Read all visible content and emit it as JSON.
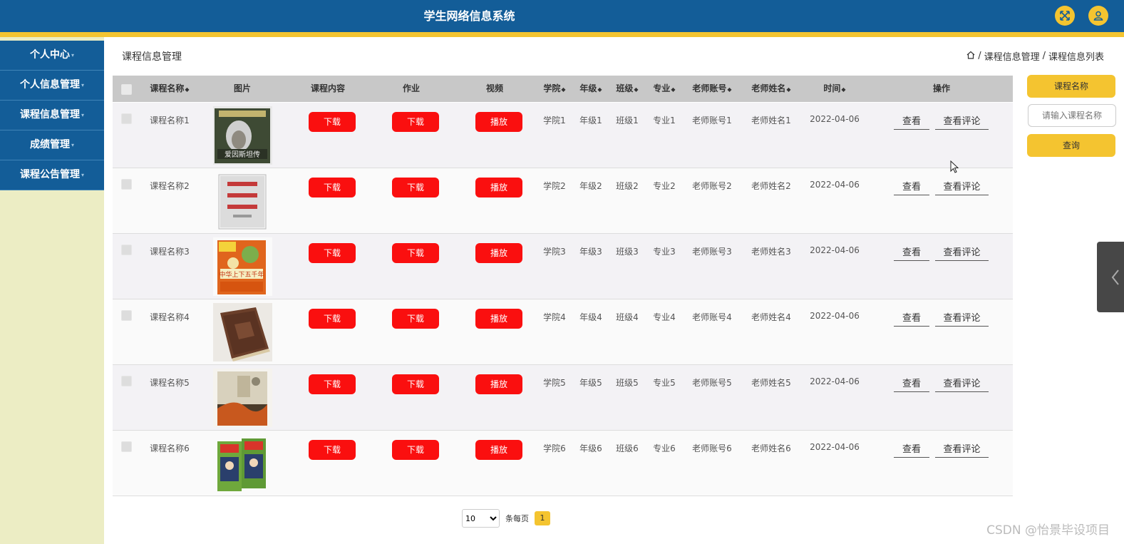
{
  "header": {
    "title": "学生网络信息系统",
    "icons": [
      "fullscreen-icon",
      "user-icon"
    ]
  },
  "sidebar": {
    "items": [
      {
        "label": "个人中心"
      },
      {
        "label": "个人信息管理"
      },
      {
        "label": "课程信息管理"
      },
      {
        "label": "成绩管理"
      },
      {
        "label": "课程公告管理"
      }
    ]
  },
  "main": {
    "title": "课程信息管理",
    "breadcrumb": {
      "home_icon": "home-icon",
      "level1": "课程信息管理",
      "separator": "/",
      "level2": "课程信息列表"
    }
  },
  "table": {
    "columns": {
      "name": "课程名称",
      "image": "图片",
      "content": "课程内容",
      "homework": "作业",
      "video": "视频",
      "college": "学院",
      "grade": "年级",
      "class": "班级",
      "major": "专业",
      "teacher_account": "老师账号",
      "teacher_name": "老师姓名",
      "time": "时间",
      "actions": "操作"
    },
    "buttons": {
      "download": "下载",
      "play": "播放",
      "view": "查看",
      "view_comments": "查看评论"
    },
    "rows": [
      {
        "name": "课程名称1",
        "college": "学院1",
        "grade": "年级1",
        "class": "班级1",
        "major": "专业1",
        "teacher_account": "老师账号1",
        "teacher_name": "老师姓名1",
        "time": "2022-04-06",
        "book_text": "爱因斯坦传"
      },
      {
        "name": "课程名称2",
        "college": "学院2",
        "grade": "年级2",
        "class": "班级2",
        "major": "专业2",
        "teacher_account": "老师账号2",
        "teacher_name": "老师姓名2",
        "time": "2022-04-06",
        "book_text": ""
      },
      {
        "name": "课程名称3",
        "college": "学院3",
        "grade": "年级3",
        "class": "班级3",
        "major": "专业3",
        "teacher_account": "老师账号3",
        "teacher_name": "老师姓名3",
        "time": "2022-04-06",
        "book_text": "中华上下五千年"
      },
      {
        "name": "课程名称4",
        "college": "学院4",
        "grade": "年级4",
        "class": "班级4",
        "major": "专业4",
        "teacher_account": "老师账号4",
        "teacher_name": "老师姓名4",
        "time": "2022-04-06",
        "book_text": ""
      },
      {
        "name": "课程名称5",
        "college": "学院5",
        "grade": "年级5",
        "class": "班级5",
        "major": "专业5",
        "teacher_account": "老师账号5",
        "teacher_name": "老师姓名5",
        "time": "2022-04-06",
        "book_text": ""
      },
      {
        "name": "课程名称6",
        "college": "学院6",
        "grade": "年级6",
        "class": "班级6",
        "major": "专业6",
        "teacher_account": "老师账号6",
        "teacher_name": "老师姓名6",
        "time": "2022-04-06",
        "book_text": ""
      }
    ]
  },
  "search": {
    "label": "课程名称",
    "placeholder": "请输入课程名称",
    "button": "查询"
  },
  "pagination": {
    "page_size": "10",
    "per_page_label": "条每页",
    "current_page": "1"
  },
  "watermark": "CSDN @怡景毕设项目",
  "colors": {
    "header": "#135d98",
    "accent": "#f4c430",
    "danger": "#fa0f0f",
    "sidebar_bg": "#ecedc4"
  }
}
